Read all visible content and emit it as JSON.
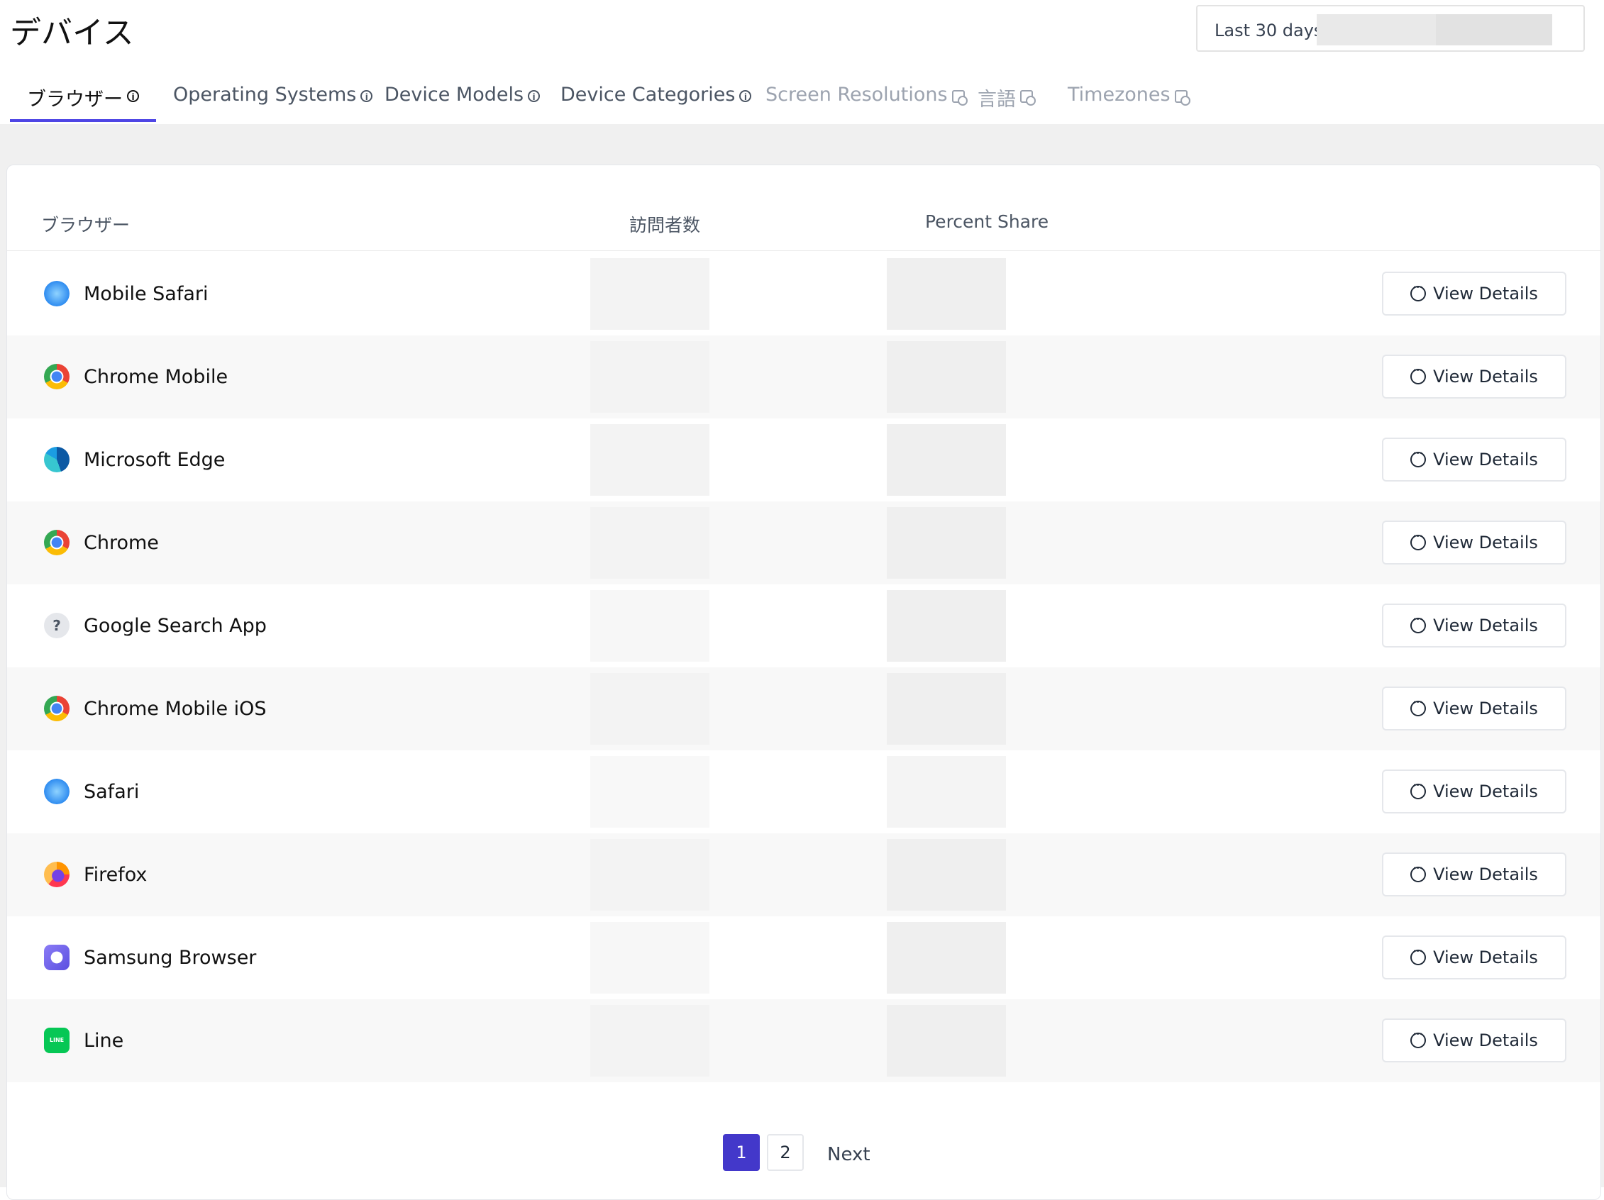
{
  "page": {
    "title": "デバイス"
  },
  "date_range": {
    "label": "Last 30 days"
  },
  "tabs": [
    {
      "label": "ブラウザー",
      "state": "active",
      "icon": "info-icon"
    },
    {
      "label": "Operating Systems",
      "state": "normal",
      "icon": "info-icon"
    },
    {
      "label": "Device Models",
      "state": "normal",
      "icon": "info-icon"
    },
    {
      "label": "Device Categories",
      "state": "normal",
      "icon": "info-icon"
    },
    {
      "label": "Screen Resolutions",
      "state": "disabled",
      "icon": "calendar-clock-icon"
    },
    {
      "label": "言語",
      "state": "disabled",
      "icon": "calendar-clock-icon"
    },
    {
      "label": "Timezones",
      "state": "disabled",
      "icon": "calendar-clock-icon"
    }
  ],
  "table": {
    "columns": [
      "ブラウザー",
      "訪問者数",
      "Percent Share"
    ],
    "action_label": "View Details",
    "rows": [
      {
        "name": "Mobile Safari",
        "icon": "safari-icon"
      },
      {
        "name": "Chrome Mobile",
        "icon": "chrome-icon"
      },
      {
        "name": "Microsoft Edge",
        "icon": "edge-icon"
      },
      {
        "name": "Chrome",
        "icon": "chrome-icon"
      },
      {
        "name": "Google Search App",
        "icon": "unknown-browser-icon"
      },
      {
        "name": "Chrome Mobile iOS",
        "icon": "chrome-icon"
      },
      {
        "name": "Safari",
        "icon": "safari-icon"
      },
      {
        "name": "Firefox",
        "icon": "firefox-icon"
      },
      {
        "name": "Samsung Browser",
        "icon": "samsung-browser-icon"
      },
      {
        "name": "Line",
        "icon": "line-icon"
      }
    ]
  },
  "pagination": {
    "current": "1",
    "next_page": "2",
    "next_label": "Next"
  },
  "colors": {
    "accent": "#4f46e5",
    "page_active": "#4338ca",
    "row_alt": "#f8f8f8"
  }
}
